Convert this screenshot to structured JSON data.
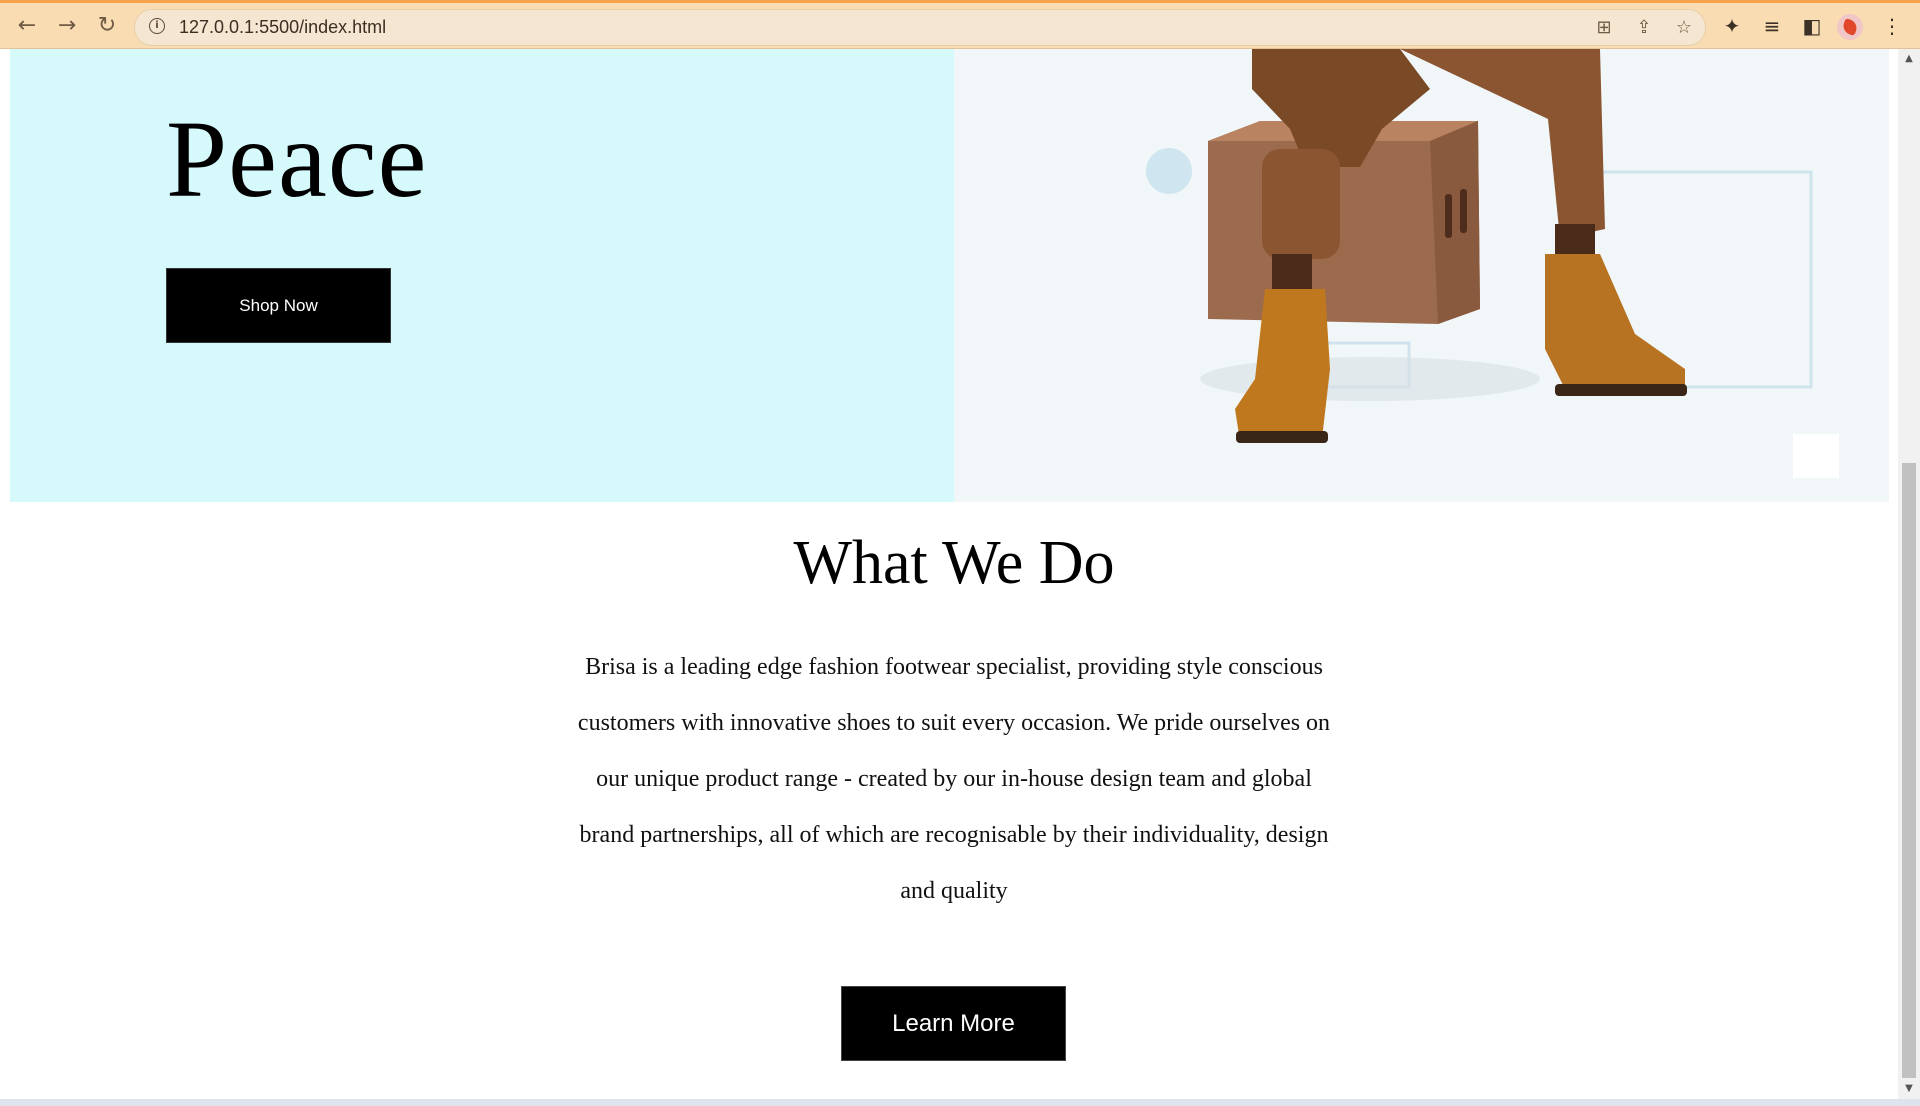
{
  "browser": {
    "url": "127.0.0.1:5500/index.html",
    "back_icon": "←",
    "forward_icon": "→",
    "reload_icon": "↻"
  },
  "hero": {
    "heading": "Peace",
    "shop_button": "Shop Now"
  },
  "about": {
    "title": "What We Do",
    "text": "Brisa is a leading edge fashion footwear specialist, providing style conscious customers with innovative shoes to suit every occasion. We pride ourselves on our unique product range - created by our in-house design team and global brand partnerships, all of which are recognisable by their individuality, design and quality",
    "learn_button": "Learn More"
  },
  "colors": {
    "hero_left_bg": "#d6fafb",
    "hero_right_bg": "#f1f7f9",
    "button_bg": "#000000",
    "chrome_bg": "#f9dcb2"
  }
}
